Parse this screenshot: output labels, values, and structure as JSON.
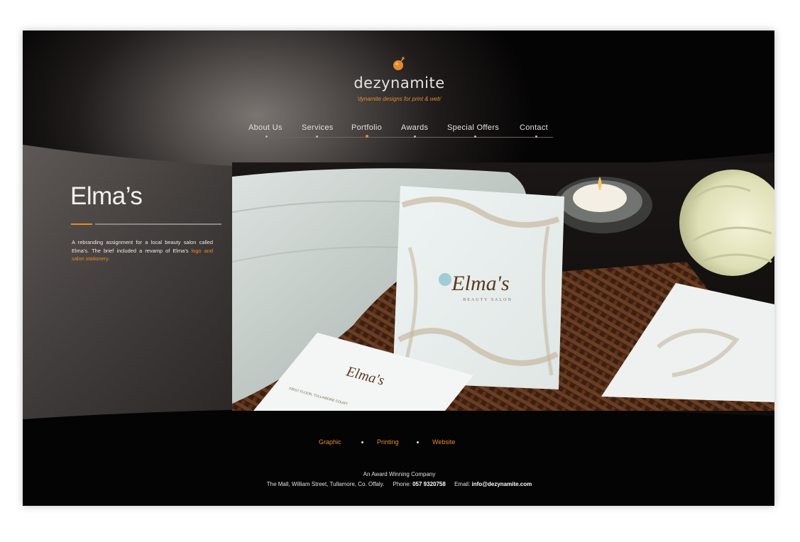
{
  "brand": {
    "name": "dezynamite",
    "tagline": "'dynamite designs for print & web'",
    "accent_color": "#e58a2b",
    "icon": "bomb-icon"
  },
  "nav": {
    "items": [
      {
        "label": "About Us"
      },
      {
        "label": "Services"
      },
      {
        "label": "Portfolio",
        "active": true
      },
      {
        "label": "Awards"
      },
      {
        "label": "Special Offers"
      },
      {
        "label": "Contact"
      }
    ]
  },
  "project": {
    "title": "Elma’s",
    "description": "A rebranding assignment for a local beauty salon called Elma’s. The brief included a revamp of Elma’s",
    "description_highlight": "logo and salon stationery.",
    "photo": {
      "card_brand": "Elma's",
      "card_subtitle": "BEAUTY SALON",
      "business_card_text": "Elma's",
      "business_card_fine": "FIRST FLOOR, TULLAMORE COURT"
    }
  },
  "footer": {
    "links": [
      {
        "label": "Graphic"
      },
      {
        "label": "Printing"
      },
      {
        "label": "Website"
      }
    ],
    "award": "An Award Winning Company",
    "address": "The Mall, William Street, Tullamore, Co. Offaly.",
    "phone_label": "Phone:",
    "phone": "057 9320758",
    "email_label": "Email:",
    "email": "info@dezynamite.com"
  }
}
